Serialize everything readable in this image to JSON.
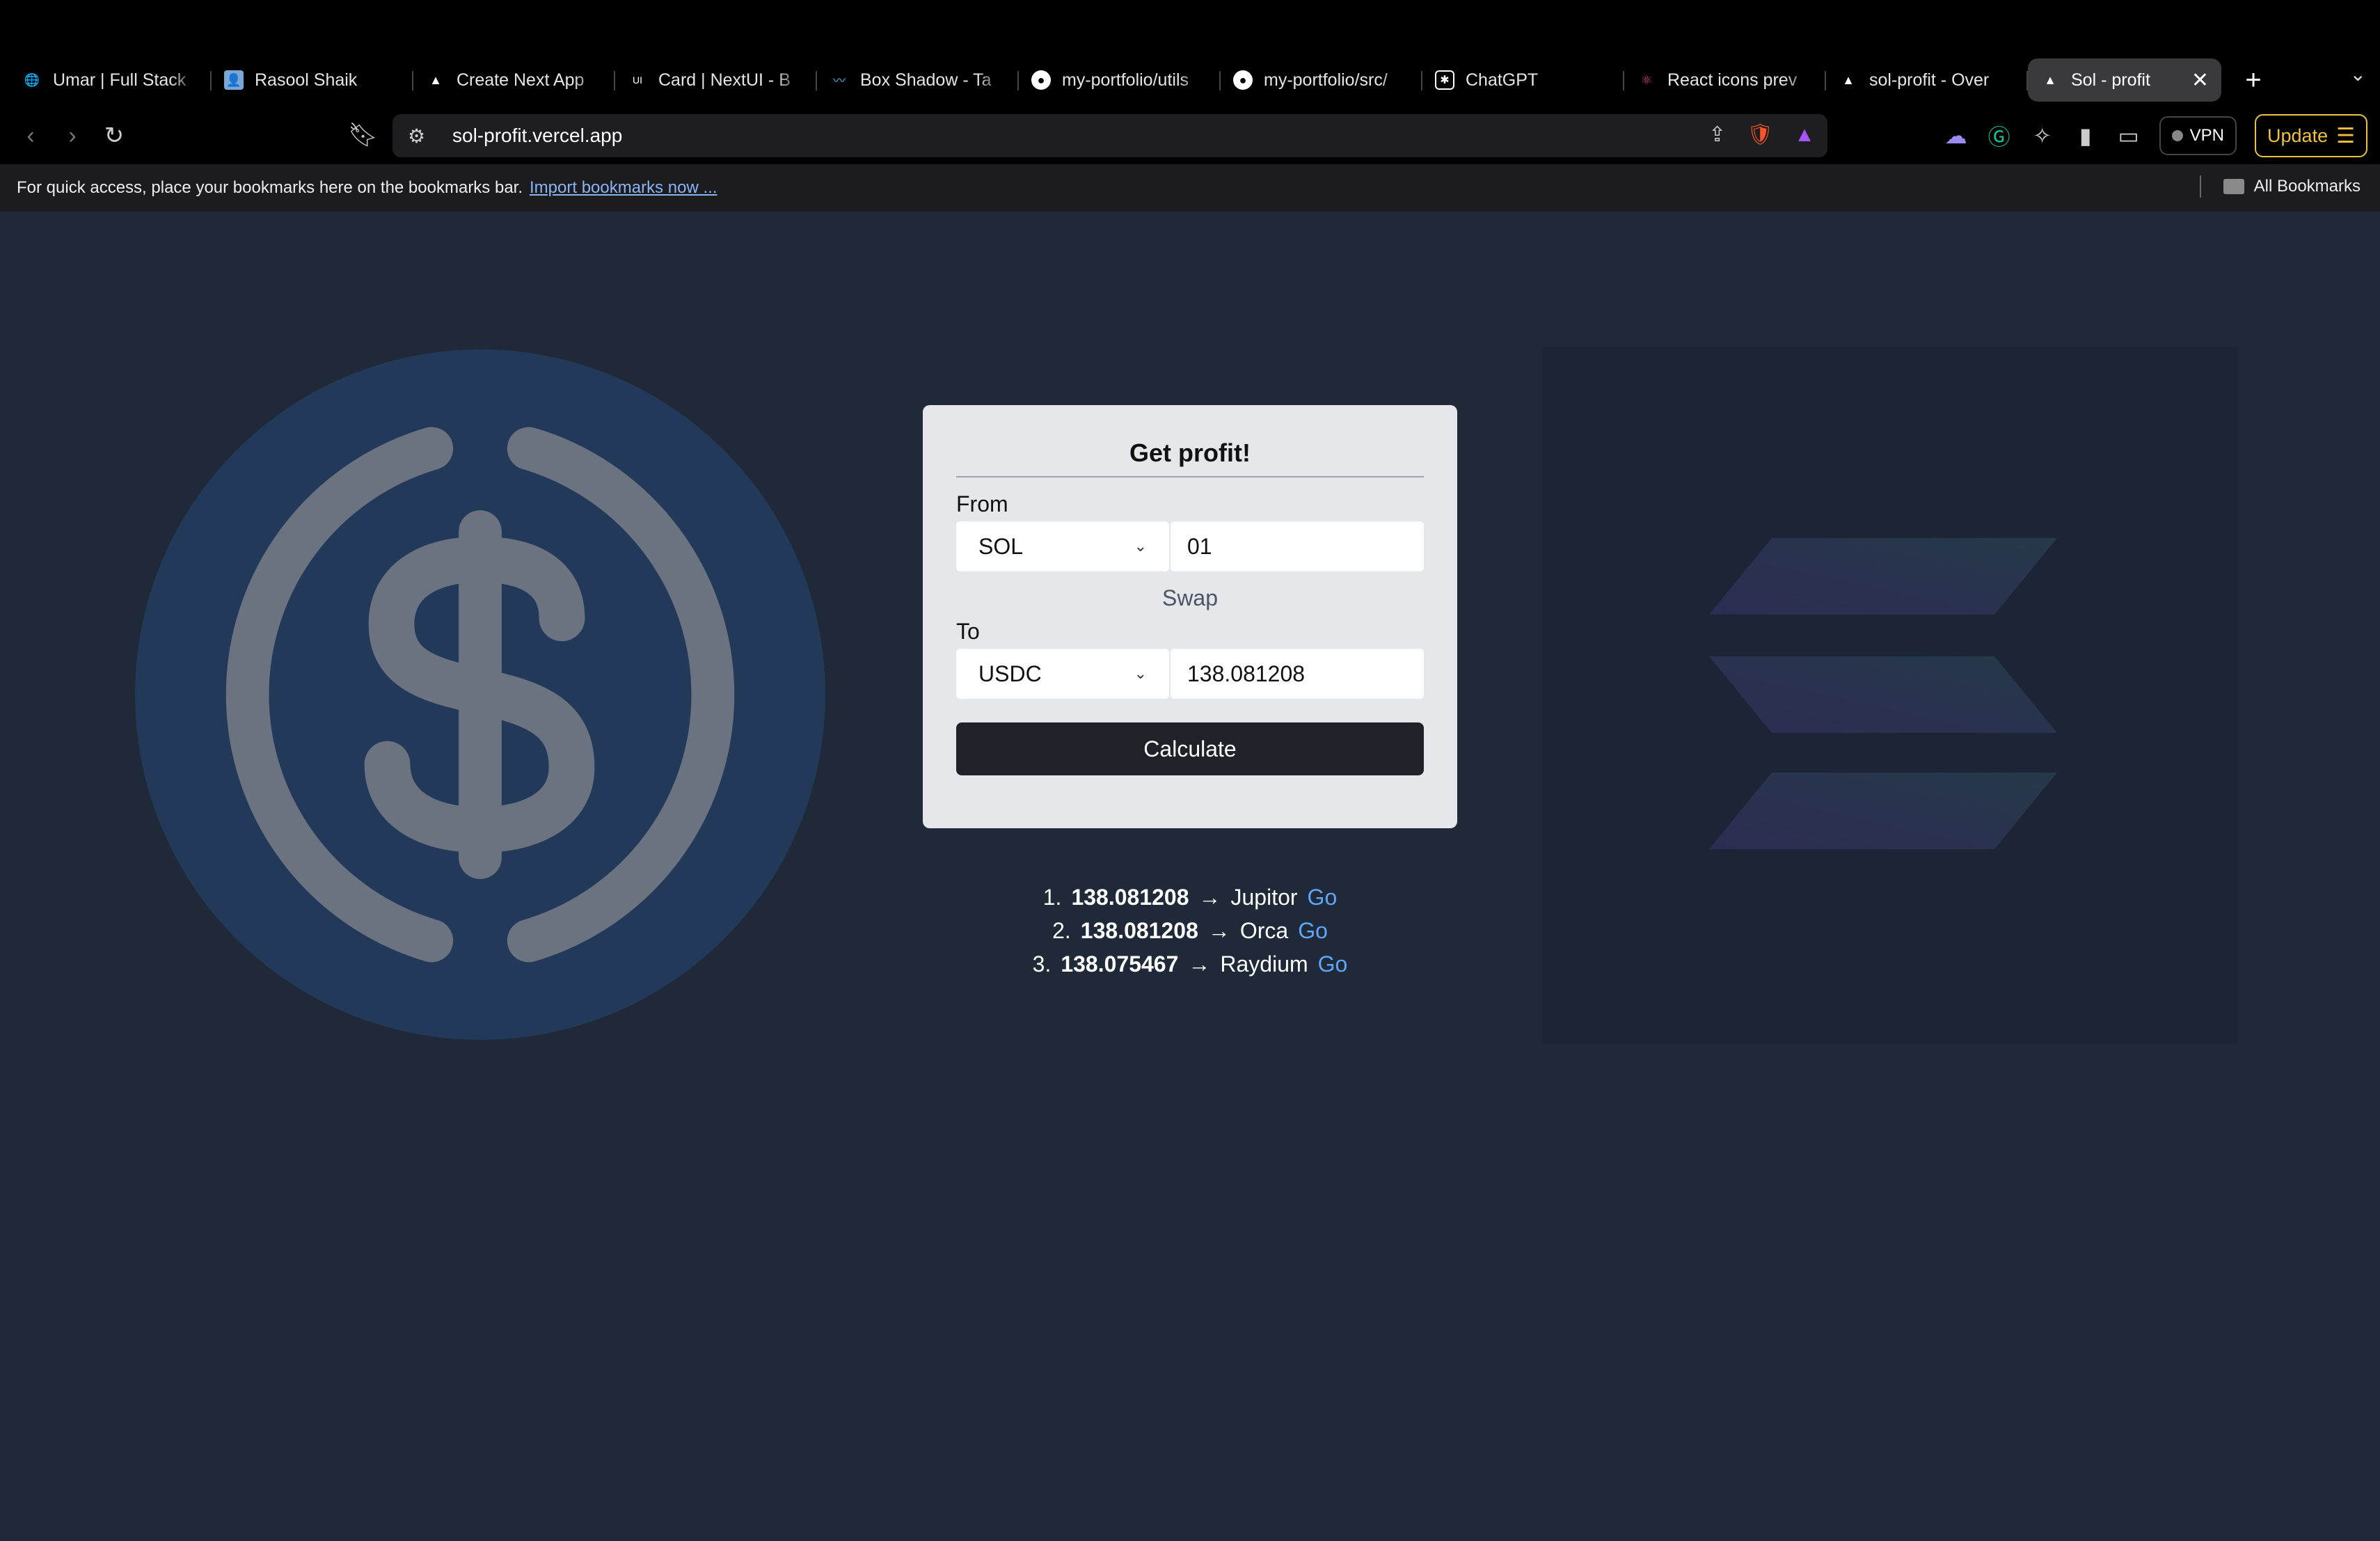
{
  "browser": {
    "tabs": [
      {
        "label": "Umar | Full Stack",
        "icon": "globe-icon",
        "active": false
      },
      {
        "label": "Rasool Shaik",
        "icon": "avatar-icon",
        "active": false
      },
      {
        "label": "Create Next App",
        "icon": "vercel-icon",
        "active": false
      },
      {
        "label": "Card | NextUI - B",
        "icon": "nextui-icon",
        "active": false
      },
      {
        "label": "Box Shadow - Ta",
        "icon": "tailwind-icon",
        "active": false
      },
      {
        "label": "my-portfolio/utils",
        "icon": "github-icon",
        "active": false
      },
      {
        "label": "my-portfolio/src/",
        "icon": "github-icon",
        "active": false
      },
      {
        "label": "ChatGPT",
        "icon": "chatgpt-icon",
        "active": false
      },
      {
        "label": "React icons prev",
        "icon": "react-icon",
        "active": false
      },
      {
        "label": "sol-profit - Over",
        "icon": "vercel-icon",
        "active": false
      },
      {
        "label": "Sol - profit",
        "icon": "vercel-icon",
        "active": true
      }
    ],
    "url": "sol-profit.vercel.app",
    "vpn_label": "VPN",
    "update_label": "Update",
    "bookmarks_hint": "For quick access, place your bookmarks here on the bookmarks bar.",
    "import_link": "Import bookmarks now ...",
    "all_bookmarks": "All Bookmarks"
  },
  "card": {
    "title": "Get profit!",
    "from_label": "From",
    "from_token": "SOL",
    "from_amount": "01",
    "swap_label": "Swap",
    "to_label": "To",
    "to_token": "USDC",
    "to_amount": "138.081208",
    "calculate_label": "Calculate"
  },
  "results": [
    {
      "rank": "1.",
      "amount": "138.081208",
      "arrow": "→",
      "dex": "Jupitor",
      "go": "Go"
    },
    {
      "rank": "2.",
      "amount": "138.081208",
      "arrow": "→",
      "dex": "Orca",
      "go": "Go"
    },
    {
      "rank": "3.",
      "amount": "138.075467",
      "arrow": "→",
      "dex": "Raydium",
      "go": "Go"
    }
  ],
  "colors": {
    "page_bg": "#1f2937",
    "usdc_circle": "#22395a",
    "usdc_symbol": "#6b7280",
    "link": "#60a5fa"
  }
}
